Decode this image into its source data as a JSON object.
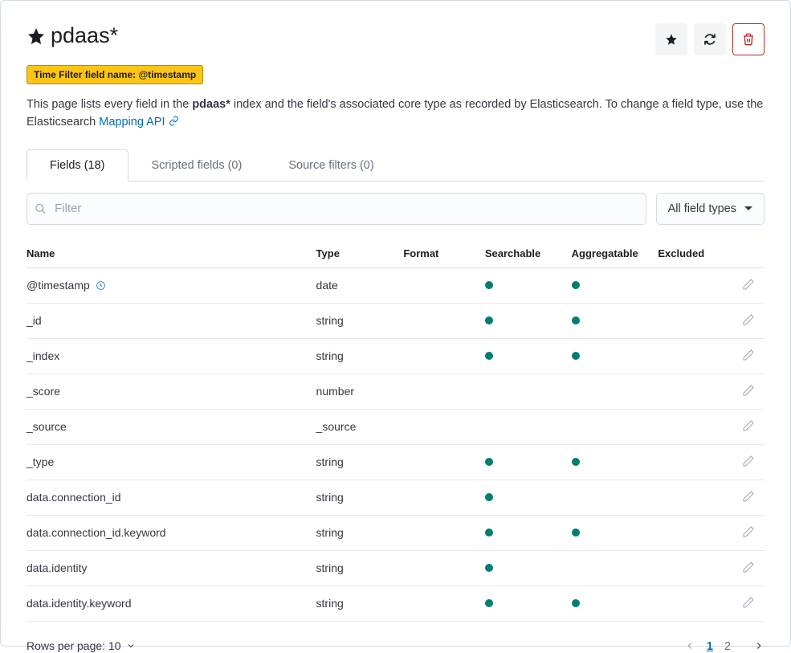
{
  "header": {
    "title": "pdaas*",
    "badge": "Time Filter field name: @timestamp",
    "description_pre": "This page lists every field in the ",
    "description_bold": "pdaas*",
    "description_mid": " index and the field's associated core type as recorded by Elasticsearch. To change a field type, use the Elasticsearch ",
    "mapping_link": "Mapping API"
  },
  "tabs": [
    {
      "label": "Fields (18)",
      "active": true
    },
    {
      "label": "Scripted fields (0)",
      "active": false
    },
    {
      "label": "Source filters (0)",
      "active": false
    }
  ],
  "filter": {
    "placeholder": "Filter",
    "type_select": "All field types"
  },
  "columns": {
    "name": "Name",
    "type": "Type",
    "format": "Format",
    "searchable": "Searchable",
    "aggregatable": "Aggregatable",
    "excluded": "Excluded"
  },
  "rows": [
    {
      "name": "@timestamp",
      "clock": true,
      "type": "date",
      "searchable": true,
      "aggregatable": true
    },
    {
      "name": "_id",
      "type": "string",
      "searchable": true,
      "aggregatable": true
    },
    {
      "name": "_index",
      "type": "string",
      "searchable": true,
      "aggregatable": true
    },
    {
      "name": "_score",
      "type": "number",
      "searchable": false,
      "aggregatable": false
    },
    {
      "name": "_source",
      "type": "_source",
      "searchable": false,
      "aggregatable": false
    },
    {
      "name": "_type",
      "type": "string",
      "searchable": true,
      "aggregatable": true
    },
    {
      "name": "data.connection_id",
      "type": "string",
      "searchable": true,
      "aggregatable": false
    },
    {
      "name": "data.connection_id.keyword",
      "type": "string",
      "searchable": true,
      "aggregatable": true
    },
    {
      "name": "data.identity",
      "type": "string",
      "searchable": true,
      "aggregatable": false
    },
    {
      "name": "data.identity.keyword",
      "type": "string",
      "searchable": true,
      "aggregatable": true
    }
  ],
  "footer": {
    "rows_per_page_label": "Rows per page: 10",
    "pages": [
      "1",
      "2"
    ],
    "current_page": "1"
  }
}
